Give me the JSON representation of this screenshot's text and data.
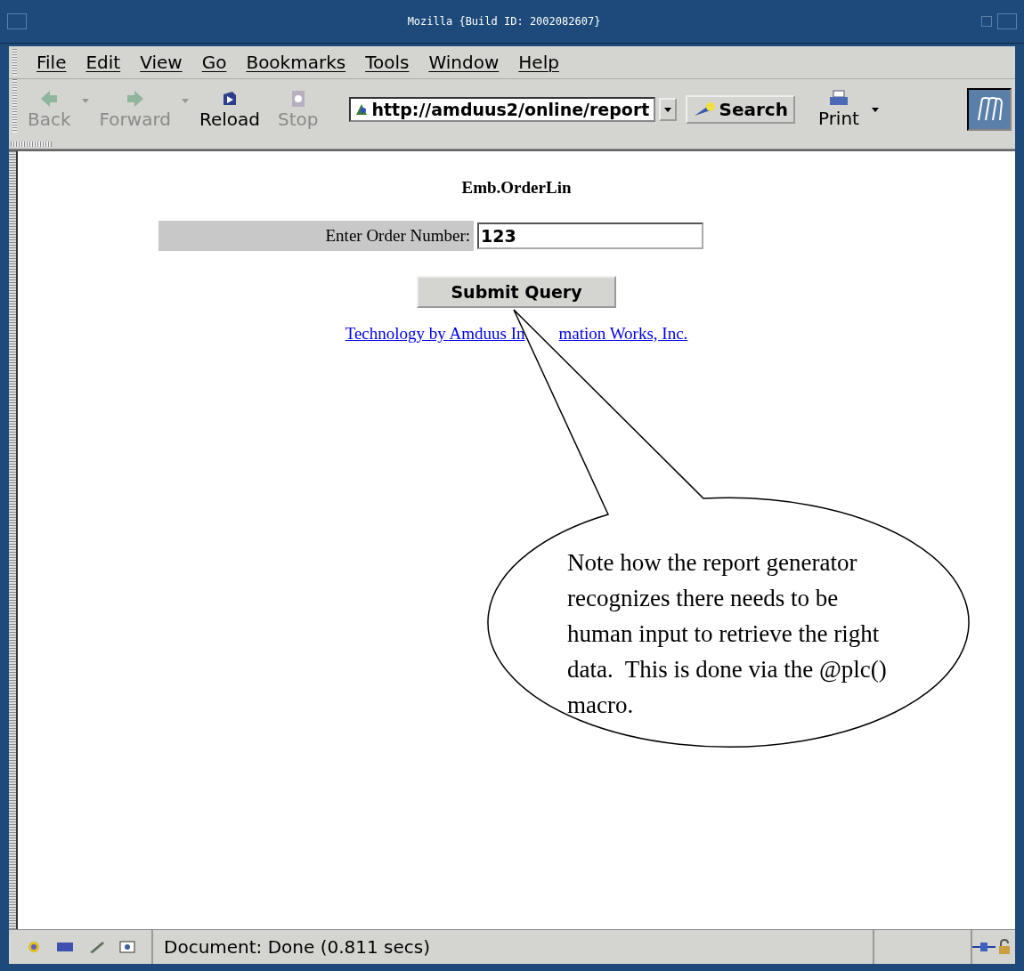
{
  "window": {
    "title": "Mozilla {Build ID: 2002082607}"
  },
  "menu": [
    "File",
    "Edit",
    "View",
    "Go",
    "Bookmarks",
    "Tools",
    "Window",
    "Help"
  ],
  "toolbar": [
    {
      "label": "Back",
      "kind": "back",
      "disabled": true,
      "dropdown": true
    },
    {
      "label": "Forward",
      "kind": "forward",
      "disabled": true,
      "dropdown": true
    },
    {
      "label": "Reload",
      "kind": "reload",
      "disabled": false,
      "dropdown": false
    },
    {
      "label": "Stop",
      "kind": "stop",
      "disabled": true,
      "dropdown": false
    }
  ],
  "url": "http://amduus2/online/report",
  "search_button": "Search",
  "print_button": "Print",
  "page": {
    "heading": "Emb.OrderLin",
    "field_label": "Enter Order Number:",
    "field_value": "123",
    "submit": "Submit Query",
    "link_parts": [
      "Technology by Amduus In",
      "mation Works, Inc."
    ]
  },
  "callout": "Note how the report generator recognizes there needs to be human input to retrieve the right data.  This is done via the @plc() macro.",
  "status_bar": {
    "text": "Document: Done (0.811 secs)"
  }
}
